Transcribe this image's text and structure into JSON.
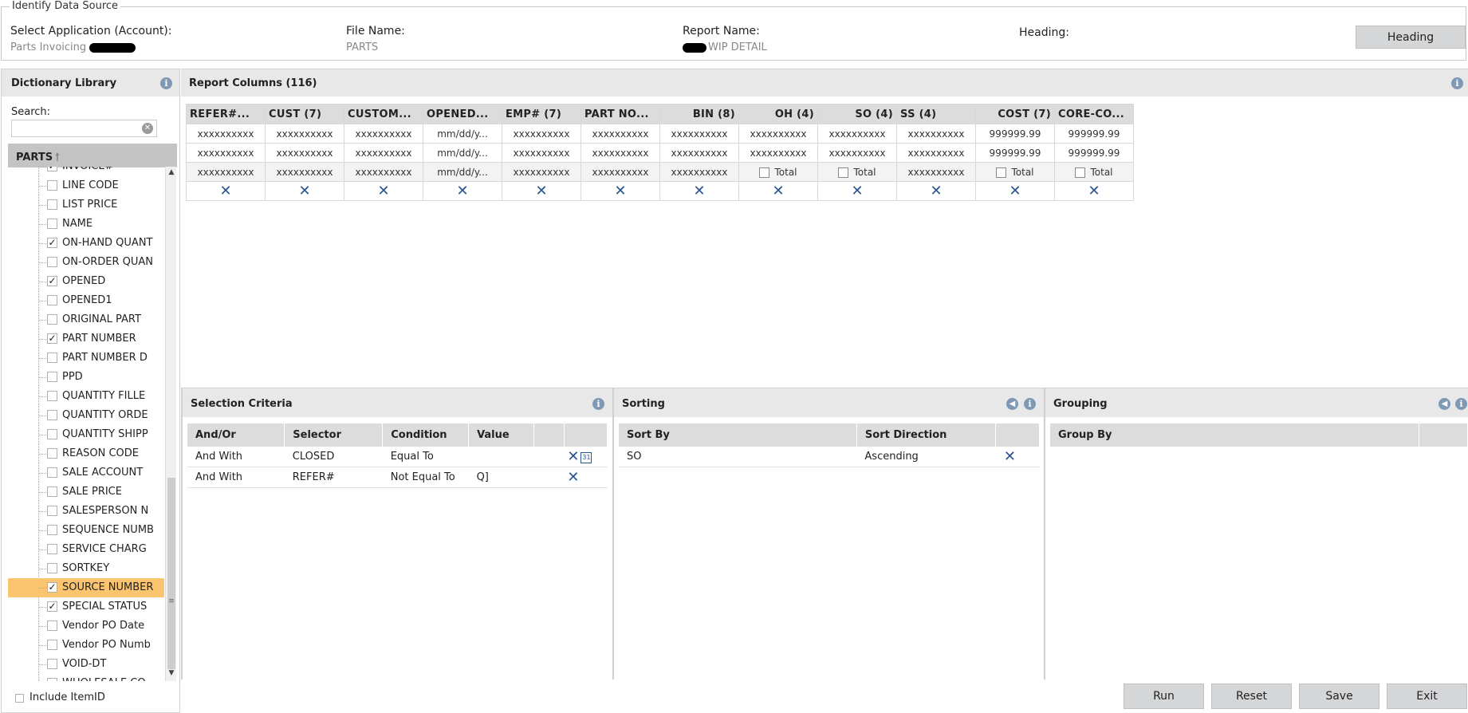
{
  "source": {
    "legend": "Identify Data Source",
    "application_label": "Select Application (Account):",
    "application_value": "Parts Invoicing",
    "file_label": "File Name:",
    "file_value": "PARTS",
    "report_label": "Report Name:",
    "report_value": "WIP DETAIL",
    "heading_label": "Heading:",
    "heading_button": "Heading"
  },
  "dictionary": {
    "title": "Dictionary Library",
    "search_label": "Search:",
    "search_value": "",
    "parts_label": "PARTS",
    "items": [
      {
        "label": "INVOICE#",
        "checked": true
      },
      {
        "label": "LINE CODE",
        "checked": false
      },
      {
        "label": "LIST PRICE",
        "checked": false
      },
      {
        "label": "NAME",
        "checked": false
      },
      {
        "label": "ON-HAND QUANT",
        "checked": true
      },
      {
        "label": "ON-ORDER QUAN",
        "checked": false
      },
      {
        "label": "OPENED",
        "checked": true
      },
      {
        "label": "OPENED1",
        "checked": false
      },
      {
        "label": "ORIGINAL PART",
        "checked": false
      },
      {
        "label": "PART NUMBER",
        "checked": true
      },
      {
        "label": "PART NUMBER D",
        "checked": false
      },
      {
        "label": "PPD",
        "checked": false
      },
      {
        "label": "QUANTITY FILLE",
        "checked": false
      },
      {
        "label": "QUANTITY ORDE",
        "checked": false
      },
      {
        "label": "QUANTITY SHIPP",
        "checked": false
      },
      {
        "label": "REASON CODE",
        "checked": false
      },
      {
        "label": "SALE ACCOUNT",
        "checked": false
      },
      {
        "label": "SALE PRICE",
        "checked": false
      },
      {
        "label": "SALESPERSON N",
        "checked": false
      },
      {
        "label": "SEQUENCE NUMB",
        "checked": false
      },
      {
        "label": "SERVICE CHARG",
        "checked": false
      },
      {
        "label": "SORTKEY",
        "checked": false
      },
      {
        "label": "SOURCE NUMBER",
        "checked": true,
        "selected": true
      },
      {
        "label": "SPECIAL STATUS",
        "checked": true
      },
      {
        "label": "Vendor PO Date",
        "checked": false
      },
      {
        "label": "Vendor PO Numb",
        "checked": false
      },
      {
        "label": "VOID-DT",
        "checked": false
      },
      {
        "label": "WHOLESALE CO",
        "checked": false
      }
    ],
    "include_itemid_label": "Include ItemID"
  },
  "report_columns": {
    "title": "Report Columns (116)",
    "columns": [
      {
        "header": "REFER#...",
        "r1": "xxxxxxxxxx",
        "r2": "xxxxxxxxxx",
        "r3": "xxxxxxxxxx",
        "r3_total": false
      },
      {
        "header": "CUST (7)",
        "r1": "xxxxxxxxxx",
        "r2": "xxxxxxxxxx",
        "r3": "xxxxxxxxxx",
        "r3_total": false
      },
      {
        "header": "CUSTOM...",
        "r1": "xxxxxxxxxx",
        "r2": "xxxxxxxxxx",
        "r3": "xxxxxxxxxx",
        "r3_total": false
      },
      {
        "header": "OPENED...",
        "r1": "mm/dd/y...",
        "r2": "mm/dd/y...",
        "r3": "mm/dd/y...",
        "r3_total": false
      },
      {
        "header": "EMP# (7)",
        "r1": "xxxxxxxxxx",
        "r2": "xxxxxxxxxx",
        "r3": "xxxxxxxxxx",
        "r3_total": false
      },
      {
        "header": "PART NO...",
        "r1": "xxxxxxxxxx",
        "r2": "xxxxxxxxxx",
        "r3": "xxxxxxxxxx",
        "r3_total": false
      },
      {
        "header": "BIN (8)",
        "r1": "xxxxxxxxxx",
        "r2": "xxxxxxxxxx",
        "r3": "xxxxxxxxxx",
        "r3_total": false
      },
      {
        "header": "OH (4)",
        "r1": "xxxxxxxxxx",
        "r2": "xxxxxxxxxx",
        "r3": "Total",
        "r3_total": true
      },
      {
        "header": "SO (4)",
        "r1": "xxxxxxxxxx",
        "r2": "xxxxxxxxxx",
        "r3": "Total",
        "r3_total": true
      },
      {
        "header": "SS (4)",
        "r1": "xxxxxxxxxx",
        "r2": "xxxxxxxxxx",
        "r3": "xxxxxxxxxx",
        "r3_total": false
      },
      {
        "header": "COST (7)",
        "r1": "999999.99",
        "r2": "999999.99",
        "r3": "Total",
        "r3_total": true
      },
      {
        "header": "CORE-CO...",
        "r1": "999999.99",
        "r2": "999999.99",
        "r3": "Total",
        "r3_total": true
      }
    ]
  },
  "selection": {
    "title": "Selection Criteria",
    "headers": [
      "And/Or",
      "Selector",
      "Condition",
      "Value"
    ],
    "rows": [
      {
        "andor": "And With",
        "selector": "CLOSED",
        "condition": "Equal To",
        "value": ""
      },
      {
        "andor": "And With",
        "selector": "REFER#",
        "condition": "Not Equal To",
        "value": "Q]"
      }
    ]
  },
  "sorting": {
    "title": "Sorting",
    "headers": [
      "Sort By",
      "Sort Direction"
    ],
    "rows": [
      {
        "sort_by": "SO",
        "direction": "Ascending"
      }
    ]
  },
  "grouping": {
    "title": "Grouping",
    "headers": [
      "Group By"
    ]
  },
  "buttons": {
    "run": "Run",
    "reset": "Reset",
    "save": "Save",
    "exit": "Exit"
  }
}
